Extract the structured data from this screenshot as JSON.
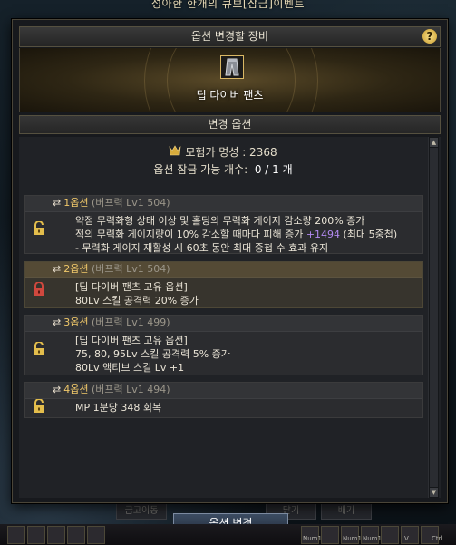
{
  "top_caption": "성아한 한개의 큐브[잠금]이벤트",
  "window": {
    "title": "옵션 변경할 장비",
    "help_symbol": "?",
    "item_name": "딥 다이버 팬츠",
    "section_title": "변경 옵션"
  },
  "adventurer_fame": {
    "icon": "fame-icon",
    "label": "모험가 명성 : 2368"
  },
  "lockable": {
    "label": "옵션 잠금 가능 개수:",
    "count": "0 / 1 개"
  },
  "options": [
    {
      "name": "1옵션",
      "tag": "(버프력 Lv1 504)",
      "lock": "unlocked",
      "lines": [
        {
          "text": "약점 무력화형 상태 이상 및 홀딩의 무력화 게이지 감소량 200% 증가"
        },
        {
          "text": "적의 무력화 게이지량이 10% 감소할 때마다 피해 증가",
          "plus": "+1494",
          "suffix": "(최대 5중첩)"
        },
        {
          "text": "- 무력화 게이지 재활성 시 60초 동안 최대 중첩 수 효과 유지"
        }
      ]
    },
    {
      "name": "2옵션",
      "tag": "(버프력 Lv1 504)",
      "lock": "locked",
      "lines": [
        {
          "text": "[딥 다이버 팬츠 고유 옵션]"
        },
        {
          "text": "80Lv 스킬 공격력 20% 증가"
        }
      ]
    },
    {
      "name": "3옵션",
      "tag": "(버프력 Lv1 499)",
      "lock": "unlocked",
      "lines": [
        {
          "text": "[딥 다이버 팬츠 고유 옵션]"
        },
        {
          "text": "75, 80, 95Lv 스킬 공격력 5% 증가"
        },
        {
          "text": "80Lv 액티브 스킬 Lv +1"
        }
      ]
    },
    {
      "name": "4옵션",
      "tag": "(버프력 Lv1 494)",
      "lock": "unlocked",
      "lines": [
        {
          "text": "MP 1분당 348 회복"
        }
      ]
    }
  ],
  "buttons": {
    "change_options": "옵션 변경"
  },
  "background_buttons": [
    "금고이동",
    "닫기",
    "배기"
  ],
  "hud_labels": [
    "Num1",
    "Num1",
    "Num1",
    "V",
    "Ctrl"
  ],
  "colors": {
    "accent_gold": "#f0c86a",
    "plus_value": "#b289f0",
    "lock_unlocked": "#e3bd4c",
    "lock_locked": "#d0483e"
  }
}
